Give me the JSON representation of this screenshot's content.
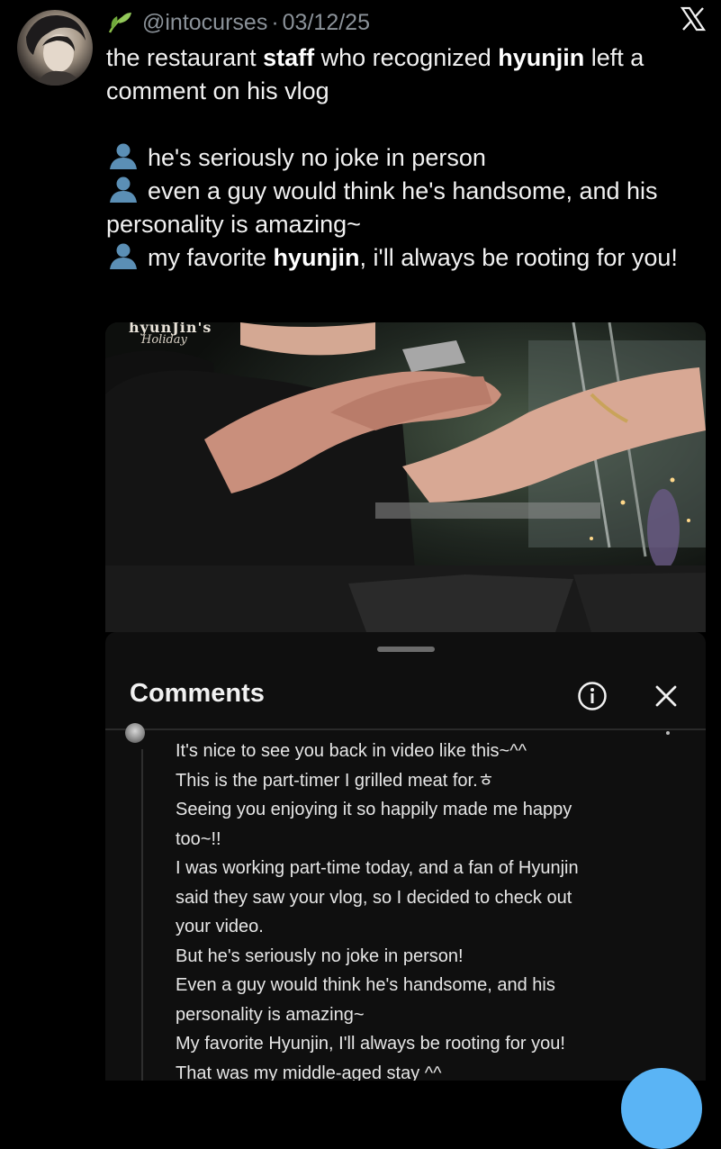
{
  "tweet": {
    "handle": "@intocurses",
    "separator": "·",
    "date": "03/12/25",
    "intro_part1": "the restaurant ",
    "intro_bold1": "staff",
    "intro_part2": " who recognized ",
    "intro_bold2": "hyunjin",
    "intro_part3": " left a comment on his vlog",
    "quote1": "he's seriously no joke in person",
    "quote2": "even a guy would think he's handsome, and his personality is amazing~",
    "quote3_part1": "my favorite ",
    "quote3_bold": "hyunjin",
    "quote3_part2": ", i'll always be rooting for you!"
  },
  "video": {
    "overlay_title": "hyunJin's",
    "overlay_subtitle": "Holiday"
  },
  "comments_panel": {
    "title": "Comments",
    "lines": [
      "It's nice to see you back in video like this~^^",
      "This is the part-timer I grilled meat for.ㅎ",
      "Seeing you enjoying it so happily made me happy",
      "too~!!",
      "I was working part-time today, and a fan of Hyunjin",
      "said they saw your vlog, so I decided to check out",
      "your video.",
      "But he's seriously no joke in person!",
      "Even a guy would think he's handsome, and his",
      "personality is amazing~",
      "My favorite Hyunjin, I'll always be rooting for you!",
      "That was my middle-aged stay ^^"
    ]
  },
  "icons": {
    "leaf": "leaf-emoji-icon",
    "x_logo": "x-logo-icon",
    "person": "bust-silhouette-icon",
    "info": "info-icon",
    "close": "close-icon"
  },
  "colors": {
    "background": "#000000",
    "panel": "#0f0f0f",
    "muted": "#8b9299",
    "person_icon": "#5b8fb5",
    "fab": "#5ab4f5"
  }
}
